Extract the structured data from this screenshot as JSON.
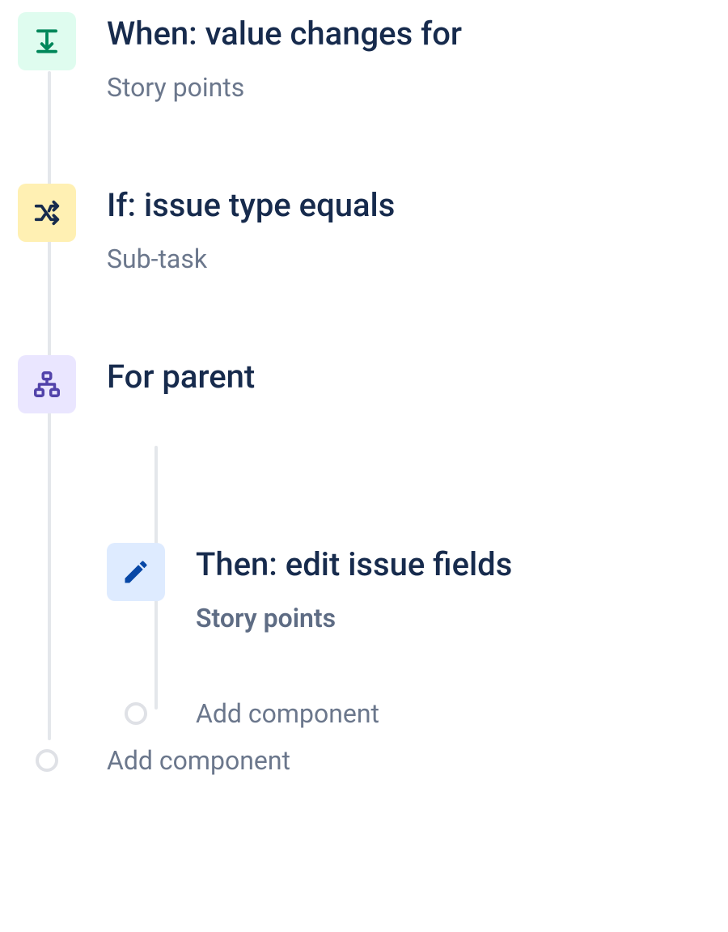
{
  "rule": {
    "trigger": {
      "title": "When: value changes for",
      "field": "Story points"
    },
    "condition": {
      "title": "If: issue type equals",
      "value": "Sub-task"
    },
    "branch": {
      "title": "For parent",
      "action": {
        "title": "Then: edit issue fields",
        "field": "Story points"
      },
      "add_label": "Add component"
    },
    "add_label": "Add component"
  },
  "colors": {
    "trigger_bg": "#dffcef",
    "condition_bg": "#fff0b3",
    "branch_bg": "#eae6ff",
    "action_bg": "#deebff",
    "heading": "#172b4d",
    "muted": "#6b778c"
  }
}
